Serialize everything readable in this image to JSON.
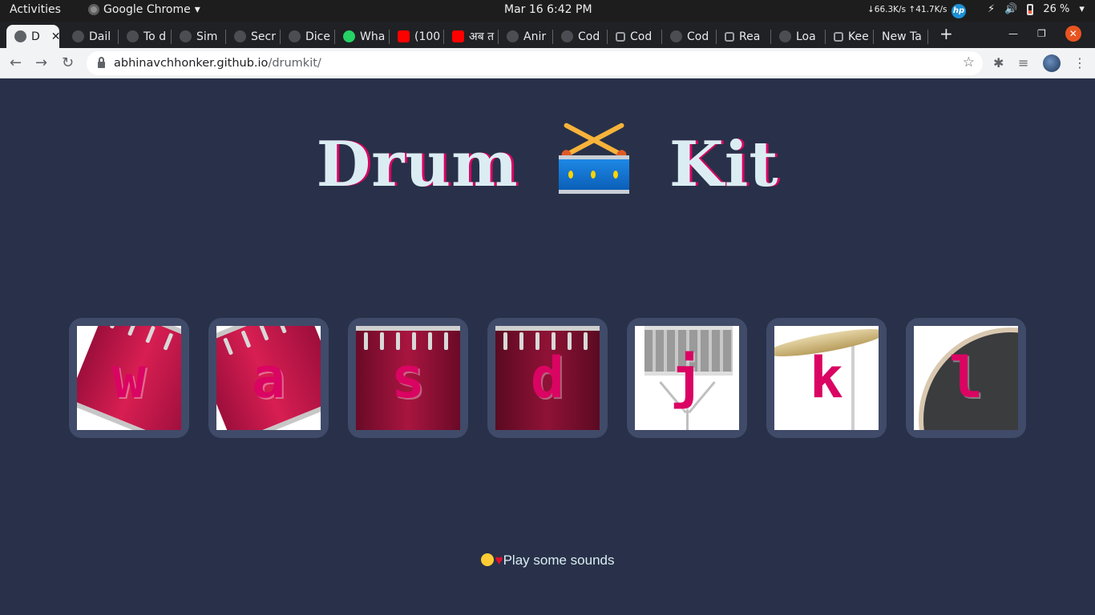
{
  "system_bar": {
    "activities": "Activities",
    "app_name": "Google Chrome",
    "datetime": "Mar 16  6:42 PM",
    "net_speed": "↓66.3K/s ↑41.7K/s",
    "hp_logo": "hp",
    "battery": "26 %"
  },
  "tabs": [
    {
      "label": "D",
      "icon": "globe-icon"
    },
    {
      "label": "Dail",
      "icon": "globe-icon"
    },
    {
      "label": "To d",
      "icon": "globe-icon"
    },
    {
      "label": "Sim",
      "icon": "globe-icon"
    },
    {
      "label": "Secr",
      "icon": "globe-icon"
    },
    {
      "label": "Dice",
      "icon": "globe-icon"
    },
    {
      "label": "Wha",
      "icon": "whatsapp-icon"
    },
    {
      "label": "(100",
      "icon": "youtube-icon"
    },
    {
      "label": "अब त",
      "icon": "youtube-icon"
    },
    {
      "label": "Anir",
      "icon": "globe-icon"
    },
    {
      "label": "Cod",
      "icon": "globe-icon"
    },
    {
      "label": "Cod",
      "icon": "cube-icon"
    },
    {
      "label": "Cod",
      "icon": "globe-icon"
    },
    {
      "label": "Rea",
      "icon": "cube-icon"
    },
    {
      "label": "Loa",
      "icon": "globe-icon"
    },
    {
      "label": "Kee",
      "icon": "cube-icon"
    },
    {
      "label": "New Ta",
      "icon": "none"
    }
  ],
  "toolbar": {
    "url_host": "abhinavchhonker.github.io",
    "url_path": "/drumkit/"
  },
  "page": {
    "title_left": "Drum",
    "title_right": "Kit",
    "drums": [
      {
        "key": "w",
        "kind": "tom-1"
      },
      {
        "key": "a",
        "kind": "tom-2"
      },
      {
        "key": "s",
        "kind": "tom-3"
      },
      {
        "key": "d",
        "kind": "tom-4"
      },
      {
        "key": "j",
        "kind": "snare"
      },
      {
        "key": "k",
        "kind": "crash"
      },
      {
        "key": "l",
        "kind": "kick-bass"
      }
    ],
    "footer_text": "Play some sounds"
  },
  "colors": {
    "background": "#283149",
    "tile": "#404b69",
    "accent": "#da0463",
    "title": "#dbedf3"
  }
}
